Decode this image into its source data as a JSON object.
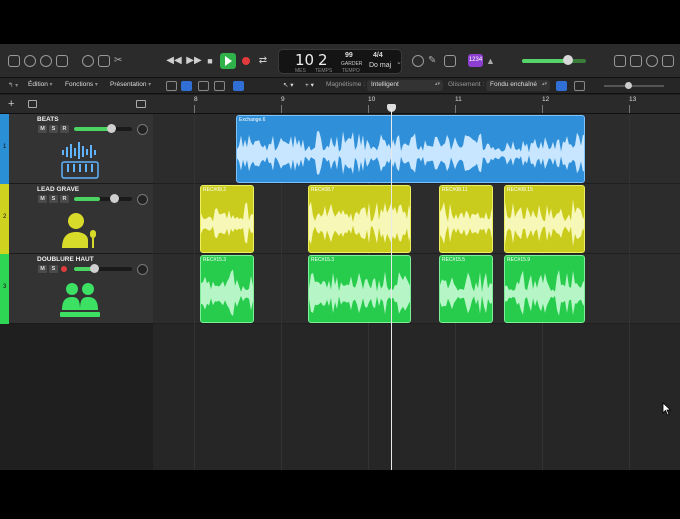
{
  "lcd": {
    "bar": "10",
    "beat": "2",
    "bar_caption": "Mes",
    "beat_caption": "Temps",
    "tempo": "99",
    "tempo_caption": "Garder",
    "tempo_sub": "Tempo",
    "signature": "4/4",
    "key": "Do maj"
  },
  "count_in_badge": "1234",
  "menus": {
    "edit": "Édition",
    "functions": "Fonctions",
    "view": "Présentation"
  },
  "snap": {
    "label": "Magnétisme :",
    "value": "Intelligent"
  },
  "drag": {
    "label": "Glissement :",
    "value": "Fondu enchaîné"
  },
  "ruler": {
    "bars": [
      "8",
      "9",
      "10",
      "11",
      "12",
      "13"
    ]
  },
  "tracks": [
    {
      "number": "1",
      "name": "BEATS",
      "color": "#2b8fd6",
      "icon": "drum-machine-icon",
      "volume": 0.62,
      "mute": "M",
      "solo": "S",
      "record": "R"
    },
    {
      "number": "2",
      "name": "LEAD GRAVE",
      "color": "#cfd21e",
      "icon": "singer-icon",
      "volume": 0.45,
      "mute": "M",
      "solo": "S",
      "record": "R"
    },
    {
      "number": "3",
      "name": "DOUBLURE HAUT",
      "color": "#2ed454",
      "icon": "choir-icon",
      "volume": 0.34,
      "mute": "M",
      "solo": "S",
      "record": "R"
    }
  ],
  "regions": {
    "beats": [
      {
        "name": "Exchange.6"
      }
    ],
    "lead": [
      {
        "name": "REC#08.2"
      },
      {
        "name": "REC#08.7"
      },
      {
        "name": "REC#08.11"
      },
      {
        "name": "REC#08.15"
      }
    ],
    "double": [
      {
        "name": "REC#15.3"
      },
      {
        "name": "REC#15.3"
      },
      {
        "name": "REC#15.5"
      },
      {
        "name": "REC#15.9"
      }
    ]
  },
  "colors": {
    "beats": "#2b8fd6",
    "lead": "#cfd21e",
    "double": "#2ed454",
    "play": "#2fb24a",
    "record": "#e23b3b"
  }
}
